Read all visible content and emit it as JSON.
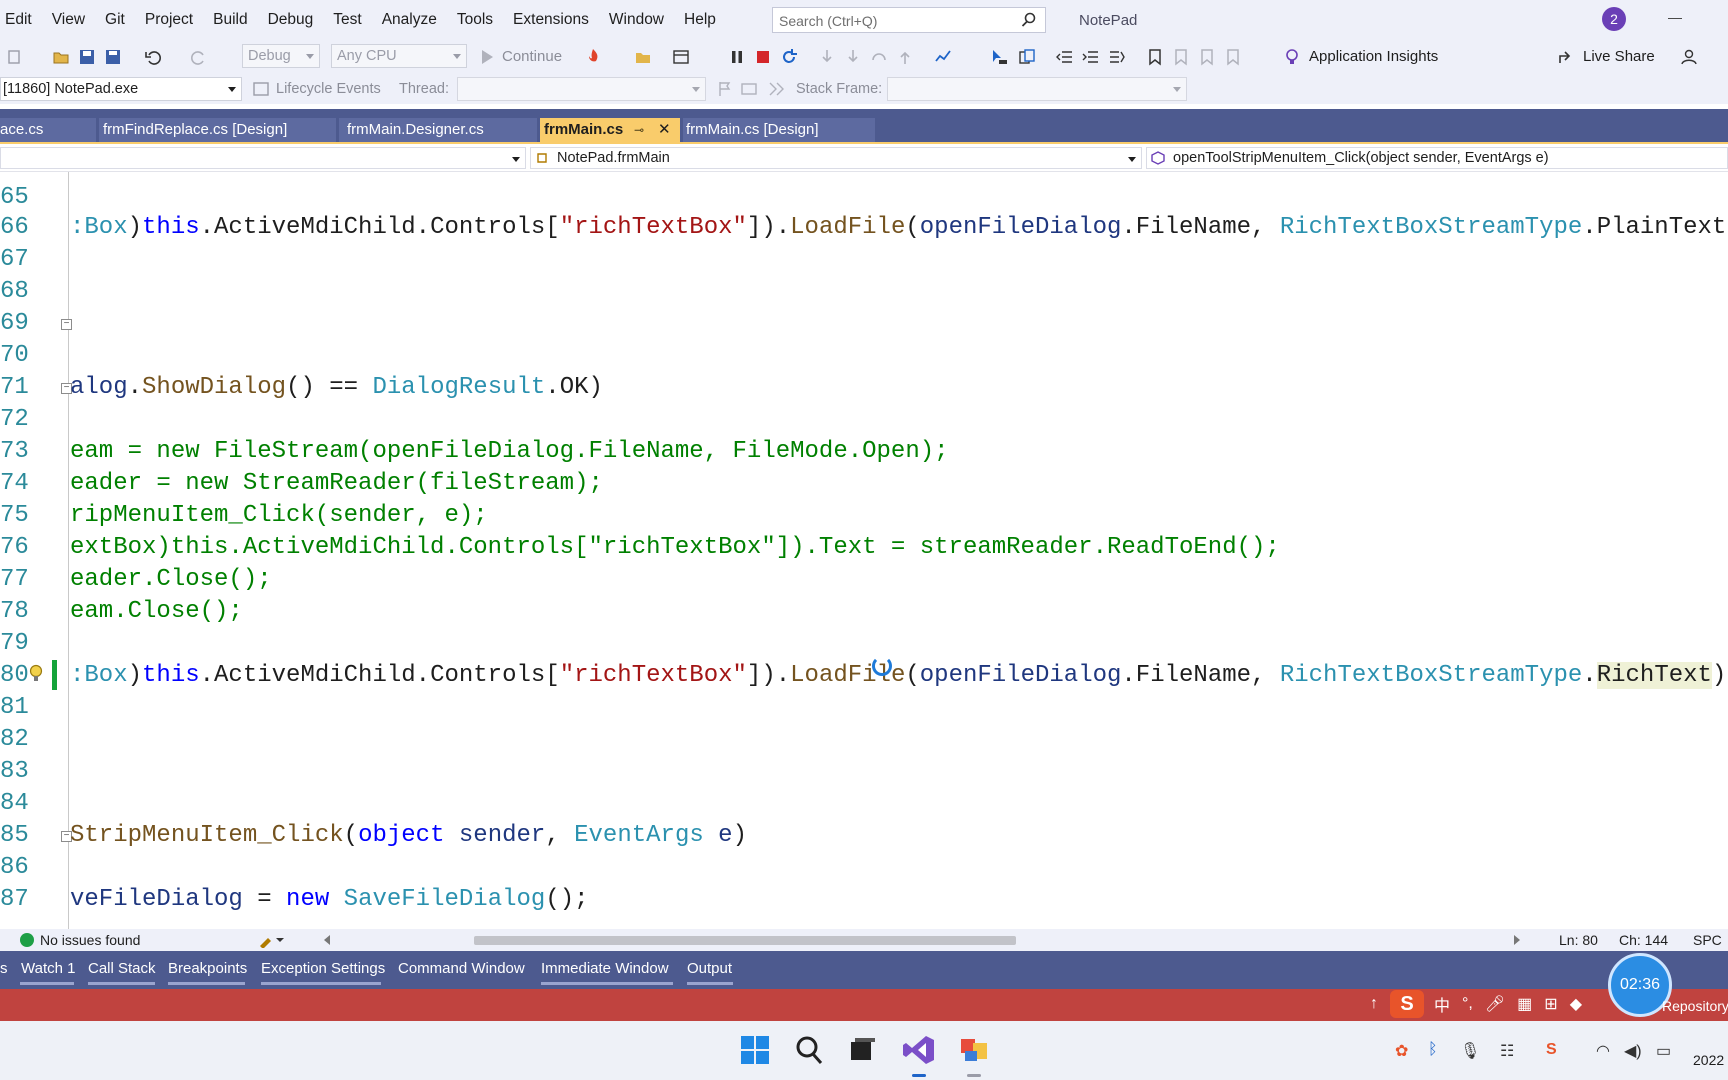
{
  "menubar": {
    "items": [
      "Edit",
      "View",
      "Git",
      "Project",
      "Build",
      "Debug",
      "Test",
      "Analyze",
      "Tools",
      "Extensions",
      "Window",
      "Help"
    ],
    "search_placeholder": "Search (Ctrl+Q)",
    "app_title": "NotePad",
    "notification_count": "2"
  },
  "toolbar1": {
    "config": "Debug",
    "platform": "Any CPU",
    "continue_label": "Continue",
    "insights_label": "Application Insights",
    "live_share_label": "Live Share"
  },
  "toolbar2": {
    "process": "[11860] NotePad.exe",
    "lifecycle_label": "Lifecycle Events",
    "thread_label": "Thread:",
    "stack_label": "Stack Frame:"
  },
  "tabs": {
    "items": [
      {
        "label": "ace.cs"
      },
      {
        "label": "frmFindReplace.cs [Design]"
      },
      {
        "label": "frmMain.Designer.cs"
      },
      {
        "label": "frmMain.cs"
      },
      {
        "label": "frmMain.cs [Design]"
      }
    ],
    "pin_glyph": "⊸",
    "close_glyph": "✕"
  },
  "navbar": {
    "scope": "",
    "class": "NotePad.frmMain",
    "member": "openToolStripMenuItem_Click(object sender, EventArgs e)"
  },
  "editor": {
    "lines": [
      {
        "n": "65"
      },
      {
        "n": "66"
      },
      {
        "n": "67"
      },
      {
        "n": "68"
      },
      {
        "n": "69"
      },
      {
        "n": "70"
      },
      {
        "n": "71"
      },
      {
        "n": "72"
      },
      {
        "n": "73"
      },
      {
        "n": "74"
      },
      {
        "n": "75"
      },
      {
        "n": "76"
      },
      {
        "n": "77"
      },
      {
        "n": "78"
      },
      {
        "n": "79"
      },
      {
        "n": "80"
      },
      {
        "n": "81"
      },
      {
        "n": "82"
      },
      {
        "n": "83"
      },
      {
        "n": "84"
      },
      {
        "n": "85"
      },
      {
        "n": "86"
      },
      {
        "n": "87"
      }
    ]
  },
  "status": {
    "issues": "No issues found",
    "line": "Ln: 80",
    "col": "Ch: 144",
    "mode": "SPC"
  },
  "toolwindows": {
    "items": [
      "s",
      "Watch 1",
      "Call Stack",
      "Breakpoints",
      "Exception Settings",
      "Command Window",
      "Immediate Window",
      "Output"
    ]
  },
  "main_status": {
    "timer": "02:36",
    "repo": "Repository"
  },
  "taskbar": {
    "clock": "2022"
  },
  "colors": {
    "accent_tab": "#f9cc6b",
    "tab_bar": "#4d5a8f",
    "status_red": "#c0433f",
    "line_numbers": "#2b8a9a"
  }
}
